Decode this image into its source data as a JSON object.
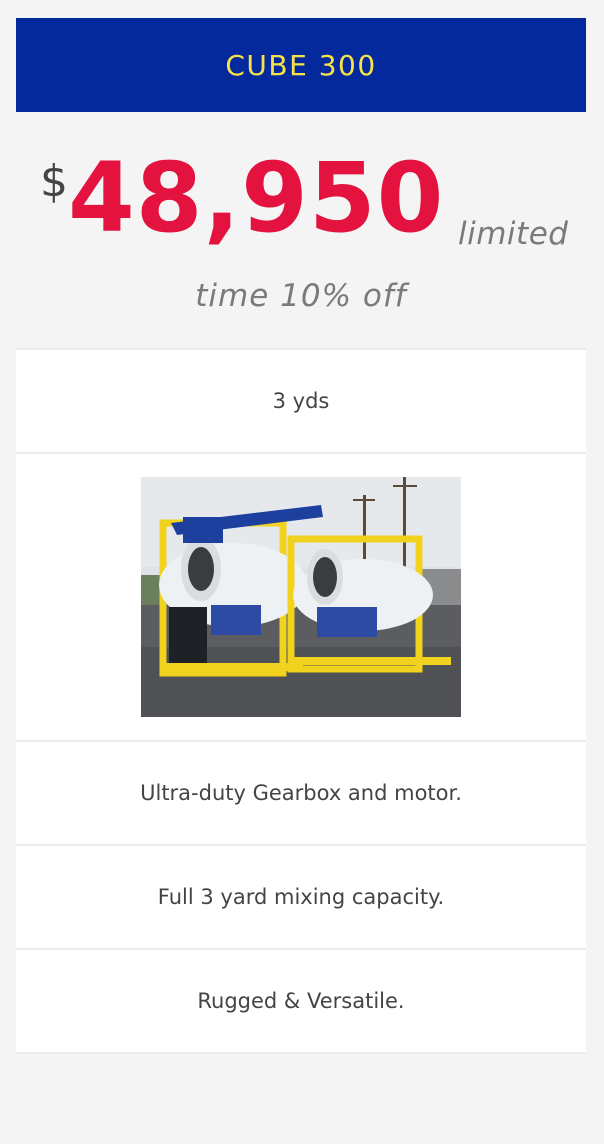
{
  "plan": {
    "title": "CUBE 300",
    "currency_symbol": "$",
    "price": "48,950",
    "price_note_part1": "limited",
    "price_note_part2": "time 10% off",
    "capacity": "3 yds",
    "features": [
      "Ultra-duty Gearbox and motor.",
      "Full 3 yard mixing capacity.",
      "Rugged & Versatile."
    ]
  },
  "colors": {
    "header_bg": "#04299d",
    "title": "#f7e24a",
    "price": "#e3123e",
    "text": "#444444"
  }
}
